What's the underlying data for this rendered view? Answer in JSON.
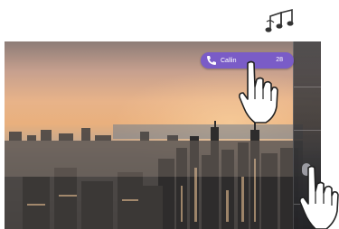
{
  "notification": {
    "label": "Callin",
    "count": "28",
    "color": "#7a5cc7",
    "icon": "phone-icon"
  },
  "status_icon": "music-notes-icon",
  "overlay_icons": [
    "hand-pointer-icon",
    "hand-pointer-icon"
  ],
  "background": "city-skyline-sunset-photo"
}
